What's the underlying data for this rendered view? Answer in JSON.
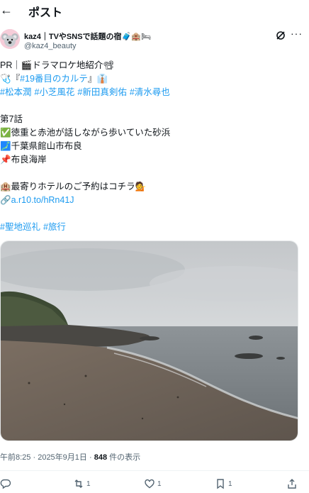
{
  "header": {
    "back_icon": "←",
    "title": "ポスト"
  },
  "author": {
    "name": "kaz4｜TVやSNSで話題の宿",
    "name_emoji": "🧳🏨🛏",
    "handle": "@kaz4_beauty",
    "avatar_icon": "koala-avatar"
  },
  "post": {
    "line1": "PR｜🎬ドラマロケ地紹介📽",
    "line2_prefix": "🩺『",
    "line2_link": "#19番目のカルテ",
    "line2_suffix": "』👔",
    "hashtags_1": [
      "#松本潤",
      "#小芝風花",
      "#新田真剣佑",
      "#清水尋也"
    ],
    "episode": "第7話",
    "check_line": "✅徳重と赤池が話しながら歩いていた砂浜",
    "location_line": "🗾千葉県館山市布良",
    "pin_line": "📌布良海岸",
    "hotel_line": "🏨最寄りホテルのご予約はコチラ💁",
    "link_prefix": "🔗",
    "link_text": "a.r10.to/hRn41J",
    "hashtags_2": [
      "#聖地巡礼",
      "#旅行"
    ]
  },
  "meta": {
    "time": "午前8:25",
    "date": "2025年9月1日",
    "views_count": "848",
    "views_label": "件の表示"
  },
  "actions": {
    "reply_count": "",
    "repost_count": "1",
    "like_count": "1",
    "bookmark_count": "1"
  },
  "colors": {
    "link": "#1d9bf0",
    "text": "#0f1419",
    "secondary": "#536471"
  }
}
